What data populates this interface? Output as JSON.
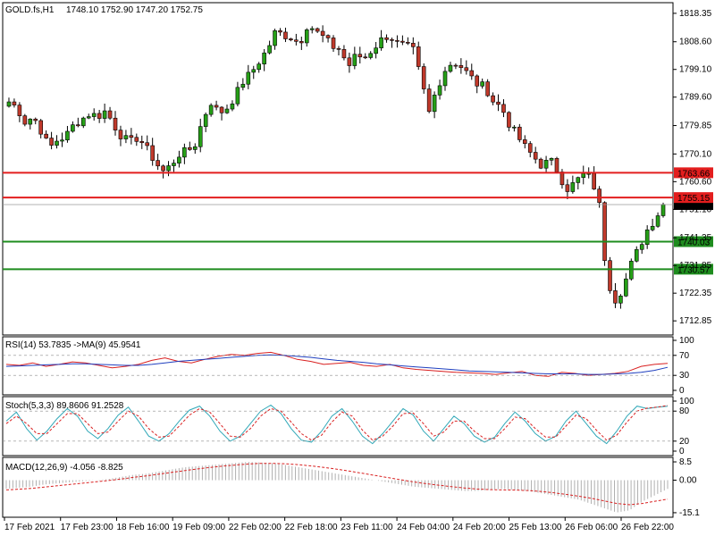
{
  "header": {
    "symbol": "GOLD.fs,H1",
    "ohlc": "1748.10 1752.90 1747.20 1752.75"
  },
  "colors": {
    "up": "#26a017",
    "down": "#c0392b",
    "support": "#1e8c1e",
    "resistance": "#e31e1e",
    "rsi_line": "#d92020",
    "ma_line": "#1f3fbf",
    "stoch_main": "#30a8b8",
    "stoch_signal": "#d92020",
    "macd_hist": "#b0b0b0",
    "macd_signal": "#d92020"
  },
  "chart_data": [
    {
      "type": "candlestick",
      "symbol": "GOLD.fs",
      "timeframe": "H1",
      "ylim": [
        1708,
        1822
      ],
      "y_ticks": [
        "1818.35",
        "1808.60",
        "1799.10",
        "1789.60",
        "1779.85",
        "1770.10",
        "1760.60",
        "1751.10",
        "1741.35",
        "1731.85",
        "1722.35",
        "1712.85"
      ],
      "current_price": "1752.75",
      "levels": [
        {
          "label": "1763.66",
          "value": 1763.66,
          "kind": "resistance"
        },
        {
          "label": "1755.15",
          "value": 1755.15,
          "kind": "resistance"
        },
        {
          "label": "1740.03",
          "value": 1740.03,
          "kind": "support"
        },
        {
          "label": "1730.57",
          "value": 1730.57,
          "kind": "support"
        }
      ],
      "path_closes": [
        1788,
        1786,
        1781,
        1783,
        1778,
        1772,
        1775,
        1776,
        1780,
        1782,
        1784,
        1783,
        1785,
        1780,
        1776,
        1774,
        1776,
        1772,
        1768,
        1764,
        1766,
        1770,
        1771,
        1773,
        1782,
        1788,
        1784,
        1786,
        1790,
        1795,
        1798,
        1802,
        1806,
        1812,
        1811,
        1810,
        1808,
        1815,
        1812,
        1810,
        1807,
        1806,
        1800,
        1804,
        1803,
        1806,
        1809,
        1811,
        1808,
        1807,
        1806,
        1796,
        1784,
        1793,
        1799,
        1802,
        1800,
        1797,
        1794,
        1793,
        1788,
        1786,
        1780,
        1776,
        1772,
        1769,
        1766,
        1768,
        1764,
        1758,
        1760,
        1763,
        1762,
        1755,
        1728,
        1720,
        1724,
        1732,
        1738,
        1744,
        1748,
        1752.75
      ]
    },
    {
      "type": "line",
      "indicator": "RSI",
      "title": "RSI(14) 53.7835  ->MA(9) 45.9541",
      "ylim": [
        0,
        100
      ],
      "y_ticks": [
        "100",
        "70",
        "30",
        "0"
      ],
      "levels": [
        70,
        30
      ],
      "series": [
        {
          "name": "RSI(14)",
          "values": [
            52,
            50,
            55,
            48,
            52,
            57,
            55,
            50,
            45,
            48,
            52,
            60,
            65,
            58,
            55,
            62,
            68,
            72,
            70,
            74,
            76,
            70,
            62,
            58,
            52,
            54,
            56,
            50,
            48,
            52,
            45,
            42,
            40,
            38,
            36,
            35,
            34,
            32,
            35,
            38,
            30,
            28,
            36,
            34,
            30,
            32,
            34,
            38,
            48,
            52,
            54
          ]
        },
        {
          "name": "MA(9)",
          "values": [
            48,
            49,
            50,
            51,
            52,
            53,
            53,
            52,
            51,
            50,
            50,
            52,
            55,
            58,
            60,
            62,
            64,
            66,
            68,
            70,
            71,
            70,
            68,
            66,
            63,
            60,
            58,
            56,
            53,
            51,
            49,
            47,
            45,
            43,
            41,
            39,
            38,
            37,
            36,
            35,
            34,
            33,
            33,
            33,
            32,
            32,
            33,
            34,
            36,
            40,
            46
          ]
        }
      ]
    },
    {
      "type": "line",
      "indicator": "Stochastic",
      "title": "Stoch(5,3,3) 89.8606 91.2528",
      "ylim": [
        0,
        100
      ],
      "y_ticks": [
        "100",
        "80",
        "20",
        "0"
      ],
      "levels": [
        80,
        20
      ],
      "series": [
        {
          "name": "Main",
          "values": [
            60,
            78,
            45,
            22,
            40,
            65,
            85,
            70,
            40,
            25,
            45,
            72,
            88,
            60,
            30,
            20,
            35,
            60,
            82,
            90,
            70,
            40,
            20,
            30,
            55,
            80,
            92,
            75,
            45,
            22,
            18,
            40,
            70,
            85,
            60,
            30,
            15,
            35,
            60,
            85,
            72,
            40,
            20,
            45,
            70,
            55,
            30,
            18,
            28,
            55,
            78,
            60,
            35,
            20,
            30,
            60,
            80,
            55,
            30,
            15,
            40,
            70,
            90,
            85,
            88,
            89.86
          ]
        },
        {
          "name": "Signal",
          "values": [
            55,
            70,
            55,
            35,
            35,
            55,
            75,
            75,
            55,
            35,
            38,
            60,
            80,
            70,
            45,
            28,
            30,
            50,
            72,
            85,
            78,
            55,
            30,
            28,
            45,
            70,
            85,
            80,
            58,
            35,
            22,
            32,
            58,
            78,
            70,
            42,
            22,
            30,
            50,
            75,
            76,
            55,
            30,
            38,
            60,
            60,
            40,
            25,
            25,
            45,
            68,
            65,
            45,
            28,
            28,
            50,
            72,
            65,
            42,
            22,
            32,
            58,
            80,
            86,
            88,
            91.25
          ]
        }
      ]
    },
    {
      "type": "bar",
      "indicator": "MACD",
      "title": "MACD(12,26,9) -4.056 -8.825",
      "y_ticks": [
        "8.5",
        "0.00",
        "-15.1"
      ],
      "ylim": [
        -15.13,
        8.51
      ],
      "series": [
        {
          "name": "MACD",
          "values": [
            -4,
            -3.5,
            -3,
            -2,
            -1.5,
            -1,
            -0.5,
            0,
            0.5,
            1.5,
            2.5,
            3,
            4,
            5,
            6,
            6.5,
            7,
            7.5,
            8,
            8.5,
            8.2,
            7.8,
            7,
            6,
            5,
            4,
            3,
            2,
            1,
            0,
            -1,
            -2,
            -3,
            -3.5,
            -4,
            -4.5,
            -5,
            -5,
            -4.5,
            -4,
            -4.5,
            -5,
            -6,
            -7,
            -8,
            -9,
            -11,
            -13,
            -15,
            -14,
            -10,
            -7,
            -4.056
          ]
        },
        {
          "name": "Signal",
          "values": [
            -4.5,
            -4.2,
            -3.8,
            -3.2,
            -2.6,
            -2,
            -1.4,
            -0.8,
            -0.2,
            0.5,
            1.3,
            2,
            2.8,
            3.6,
            4.4,
            5.2,
            5.9,
            6.5,
            7,
            7.5,
            7.8,
            7.8,
            7.6,
            7.2,
            6.6,
            5.9,
            5.1,
            4.2,
            3.2,
            2.2,
            1.2,
            0.2,
            -0.8,
            -1.6,
            -2.3,
            -3,
            -3.6,
            -4.1,
            -4.4,
            -4.5,
            -4.6,
            -4.8,
            -5.2,
            -5.8,
            -6.6,
            -7.4,
            -8.4,
            -9.6,
            -10.8,
            -11.4,
            -10.8,
            -9.8,
            -8.825
          ]
        }
      ]
    }
  ],
  "x_labels": [
    "17 Feb 2021",
    "17 Feb 23:00",
    "18 Feb 16:00",
    "19 Feb 09:00",
    "22 Feb 02:00",
    "22 Feb 18:00",
    "23 Feb 11:00",
    "24 Feb 04:00",
    "24 Feb 20:00",
    "25 Feb 13:00",
    "26 Feb 06:00",
    "26 Feb 22:00"
  ]
}
